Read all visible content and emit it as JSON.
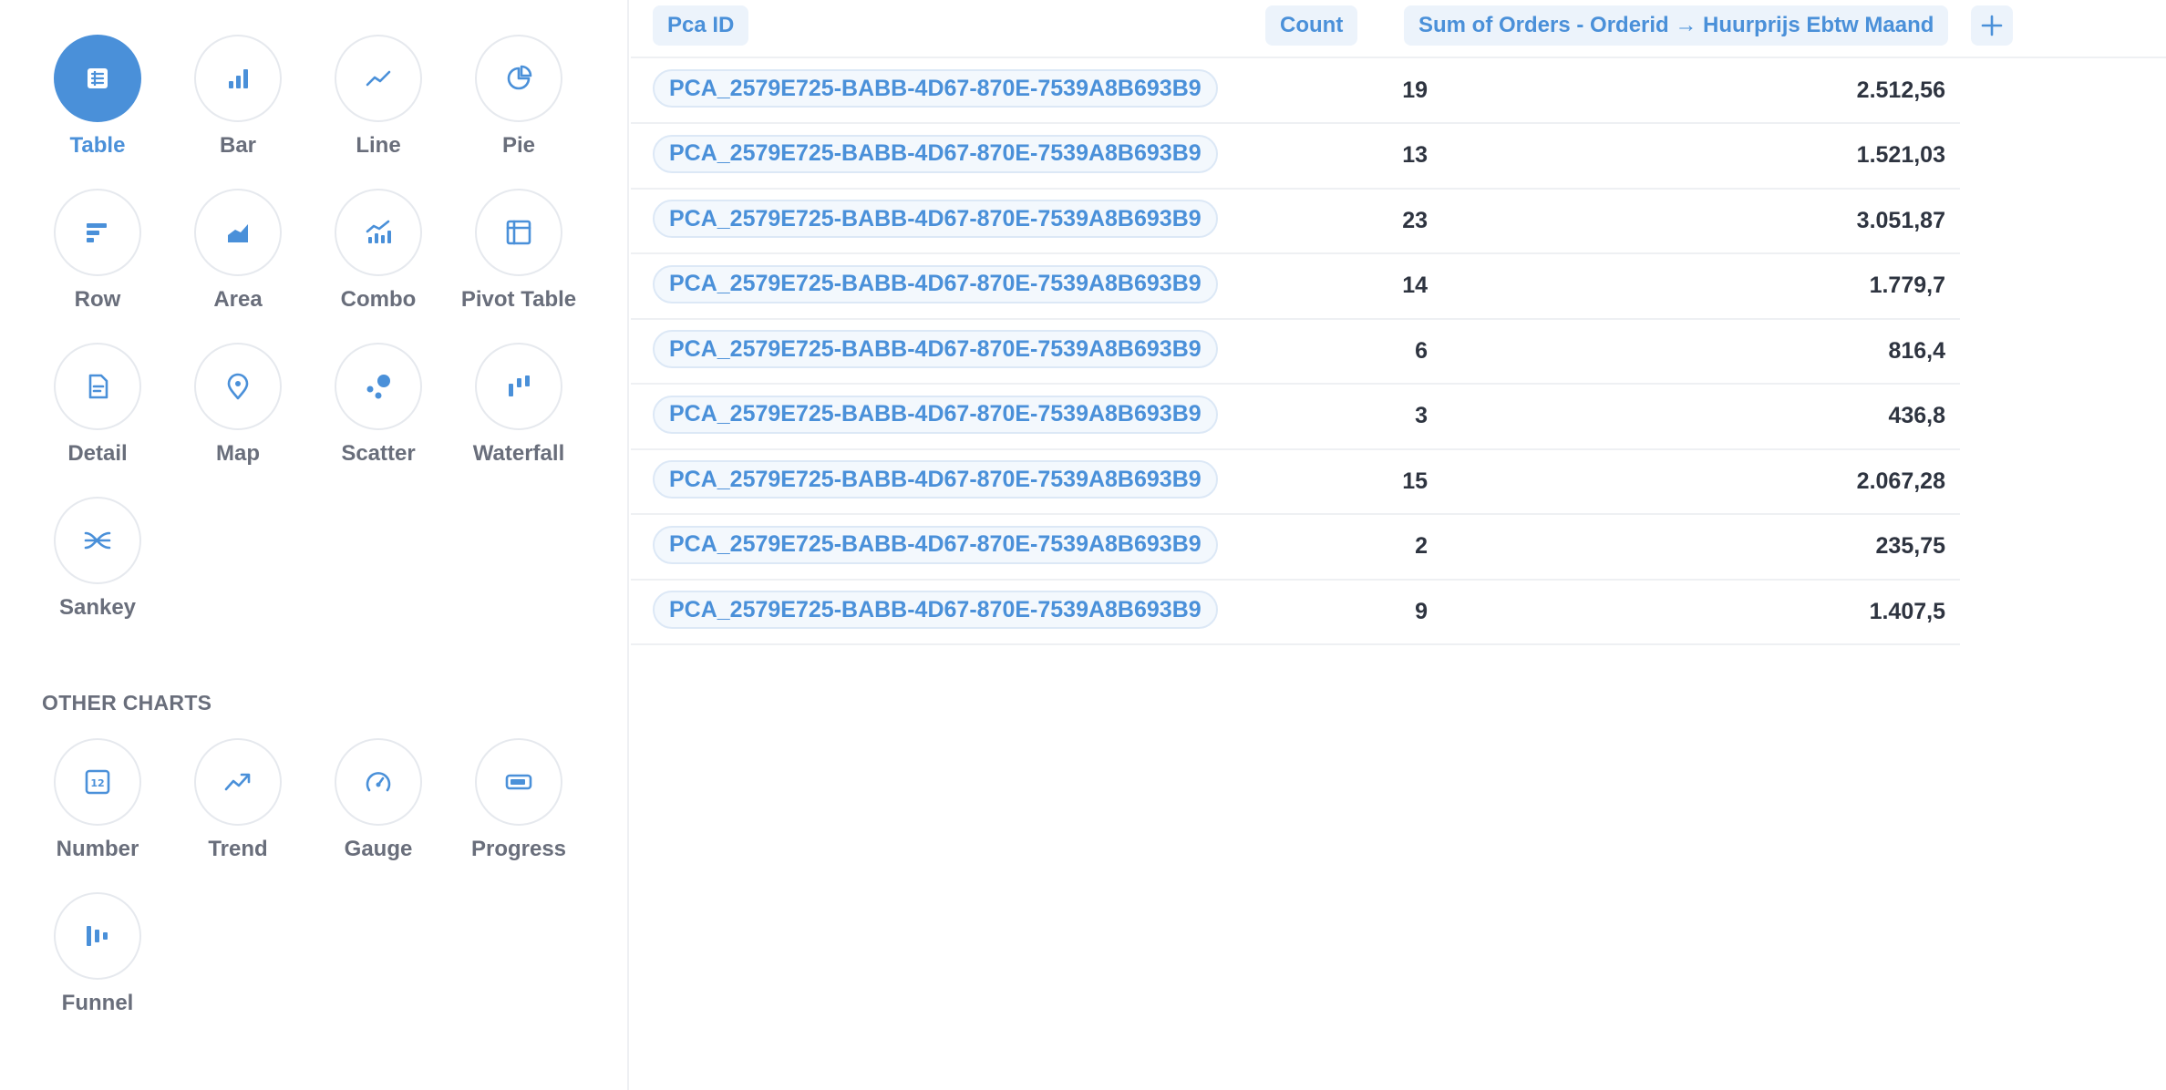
{
  "colors": {
    "accent": "#4a90d9",
    "icon_stroke": "#4a90d9",
    "selected_icon": "#ffffff",
    "label_text": "#696e7b",
    "cell_text": "#2e3440",
    "pill_bg": "#ecf3fb"
  },
  "sidebar": {
    "visualizations": [
      {
        "label": "Table",
        "icon": "table-icon",
        "selected": true
      },
      {
        "label": "Bar",
        "icon": "bar-chart-icon"
      },
      {
        "label": "Line",
        "icon": "line-chart-icon"
      },
      {
        "label": "Pie",
        "icon": "pie-chart-icon"
      },
      {
        "label": "Row",
        "icon": "row-chart-icon"
      },
      {
        "label": "Area",
        "icon": "area-chart-icon"
      },
      {
        "label": "Combo",
        "icon": "combo-chart-icon"
      },
      {
        "label": "Pivot Table",
        "icon": "pivot-table-icon"
      },
      {
        "label": "Detail",
        "icon": "detail-icon"
      },
      {
        "label": "Map",
        "icon": "map-pin-icon"
      },
      {
        "label": "Scatter",
        "icon": "scatter-icon"
      },
      {
        "label": "Waterfall",
        "icon": "waterfall-icon"
      },
      {
        "label": "Sankey",
        "icon": "sankey-icon"
      }
    ],
    "other_charts_title": "OTHER CHARTS",
    "other_charts": [
      {
        "label": "Number",
        "icon": "number-icon"
      },
      {
        "label": "Trend",
        "icon": "trend-icon"
      },
      {
        "label": "Gauge",
        "icon": "gauge-icon"
      },
      {
        "label": "Progress",
        "icon": "progress-icon"
      },
      {
        "label": "Funnel",
        "icon": "funnel-icon"
      }
    ]
  },
  "table": {
    "columns": {
      "pca_id": "Pca ID",
      "count": "Count",
      "sum": "Sum of Orders - Orderid → Huurprijs Ebtw Maand"
    },
    "add_column_icon": "plus-icon",
    "rows": [
      {
        "pca_id": "PCA_2579E725-BABB-4D67-870E-7539A8B693B9",
        "count": "19",
        "sum": "2.512,56"
      },
      {
        "pca_id": "PCA_2579E725-BABB-4D67-870E-7539A8B693B9",
        "count": "13",
        "sum": "1.521,03"
      },
      {
        "pca_id": "PCA_2579E725-BABB-4D67-870E-7539A8B693B9",
        "count": "23",
        "sum": "3.051,87"
      },
      {
        "pca_id": "PCA_2579E725-BABB-4D67-870E-7539A8B693B9",
        "count": "14",
        "sum": "1.779,7"
      },
      {
        "pca_id": "PCA_2579E725-BABB-4D67-870E-7539A8B693B9",
        "count": "6",
        "sum": "816,4"
      },
      {
        "pca_id": "PCA_2579E725-BABB-4D67-870E-7539A8B693B9",
        "count": "3",
        "sum": "436,8"
      },
      {
        "pca_id": "PCA_2579E725-BABB-4D67-870E-7539A8B693B9",
        "count": "15",
        "sum": "2.067,28"
      },
      {
        "pca_id": "PCA_2579E725-BABB-4D67-870E-7539A8B693B9",
        "count": "2",
        "sum": "235,75"
      },
      {
        "pca_id": "PCA_2579E725-BABB-4D67-870E-7539A8B693B9",
        "count": "9",
        "sum": "1.407,5"
      }
    ]
  }
}
